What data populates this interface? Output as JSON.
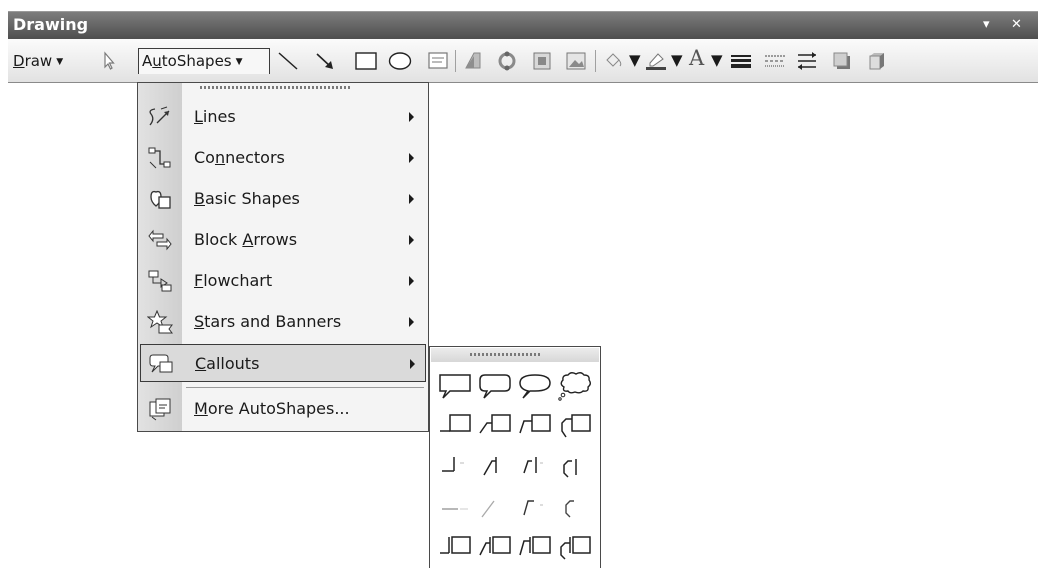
{
  "window": {
    "title": "Drawing",
    "dropdown_glyph": "▾",
    "close_glyph": "✕"
  },
  "toolbar": {
    "draw_label": "Draw",
    "draw_mnemonic": "D",
    "autoshapes_label_pre": "A",
    "autoshapes_mnemonic": "u",
    "autoshapes_label_post": "toShapes",
    "dropdown_arrow": "▼",
    "tools": [
      "select-objects-icon",
      "line-icon",
      "arrow-icon",
      "rectangle-icon",
      "oval-icon",
      "text-box-icon",
      "wordart-icon",
      "diagram-icon",
      "clip-art-icon",
      "picture-icon",
      "fill-color-icon",
      "line-color-icon",
      "font-color-icon",
      "line-style-icon",
      "dash-style-icon",
      "arrow-style-icon",
      "shadow-style-icon",
      "3d-style-icon"
    ],
    "font_color_glyph": "A"
  },
  "autoshapes_menu": {
    "items": [
      {
        "mnemonic": "L",
        "rest": "ines",
        "pre": "",
        "icon": "lines-icon",
        "submenu": true
      },
      {
        "pre": "Co",
        "mnemonic": "n",
        "rest": "nectors",
        "icon": "connectors-icon",
        "submenu": true
      },
      {
        "pre": "",
        "mnemonic": "B",
        "rest": "asic Shapes",
        "icon": "basic-shapes-icon",
        "submenu": true
      },
      {
        "pre": "Block ",
        "mnemonic": "A",
        "rest": "rrows",
        "icon": "block-arrows-icon",
        "submenu": true
      },
      {
        "pre": "",
        "mnemonic": "F",
        "rest": "lowchart",
        "icon": "flowchart-icon",
        "submenu": true
      },
      {
        "pre": "",
        "mnemonic": "S",
        "rest": "tars and Banners",
        "icon": "stars-banners-icon",
        "submenu": true
      },
      {
        "pre": "",
        "mnemonic": "C",
        "rest": "allouts",
        "icon": "callouts-icon",
        "submenu": true,
        "active": true
      },
      {
        "pre": "",
        "mnemonic": "M",
        "rest": "ore AutoShapes...",
        "icon": "more-autoshapes-icon",
        "submenu": false
      }
    ]
  },
  "callouts_palette": {
    "rows": [
      [
        "rectangular-callout-icon",
        "rounded-rectangular-callout-icon",
        "oval-callout-icon",
        "cloud-callout-icon"
      ],
      [
        "line-callout-1-icon",
        "line-callout-2-icon",
        "line-callout-3-icon",
        "line-callout-4-icon"
      ],
      [
        "line-callout-1-no-border-icon",
        "line-callout-2-no-border-icon",
        "line-callout-3-no-border-icon",
        "line-callout-4-no-border-icon"
      ],
      [
        "line-callout-1-accent-bar-icon",
        "line-callout-2-accent-bar-icon",
        "line-callout-3-accent-bar-icon",
        "line-callout-4-accent-bar-icon"
      ],
      [
        "line-callout-1-border-accent-icon",
        "line-callout-2-border-accent-icon",
        "line-callout-3-border-accent-icon",
        "line-callout-4-border-accent-icon"
      ]
    ]
  },
  "colors": {
    "titlebar": "#5e5e5e",
    "menu_background": "#f4f4f4",
    "highlight": "#dadada"
  }
}
